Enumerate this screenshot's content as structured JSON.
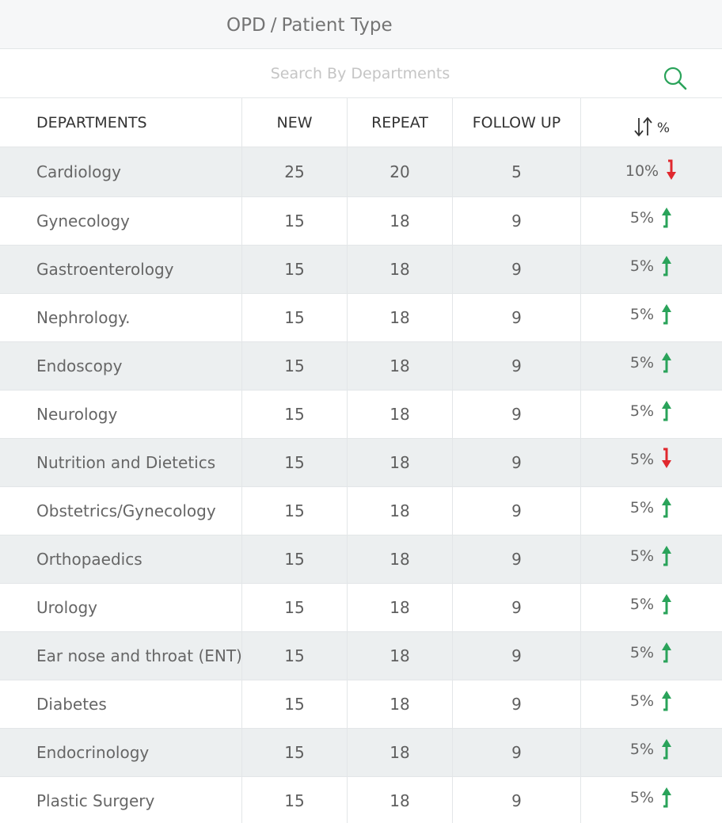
{
  "header": {
    "breadcrumb": [
      "OPD",
      "Patient Type"
    ],
    "separator": "/"
  },
  "search": {
    "placeholder": "Search By Departments",
    "value": ""
  },
  "table": {
    "columns": [
      "DEPARTMENTS",
      "NEW",
      "REPEAT",
      "FOLLOW UP"
    ],
    "pct_label": "%",
    "rows": [
      {
        "dept": "Cardiology",
        "new": "25",
        "repeat": "20",
        "follow_up": "5",
        "pct": "10%",
        "trend": "down"
      },
      {
        "dept": "Gynecology",
        "new": "15",
        "repeat": "18",
        "follow_up": "9",
        "pct": "5%",
        "trend": "up"
      },
      {
        "dept": "Gastroenterology",
        "new": "15",
        "repeat": "18",
        "follow_up": "9",
        "pct": "5%",
        "trend": "up"
      },
      {
        "dept": "Nephrology.",
        "new": "15",
        "repeat": "18",
        "follow_up": "9",
        "pct": "5%",
        "trend": "up"
      },
      {
        "dept": "Endoscopy",
        "new": "15",
        "repeat": "18",
        "follow_up": "9",
        "pct": "5%",
        "trend": "up"
      },
      {
        "dept": "Neurology",
        "new": "15",
        "repeat": "18",
        "follow_up": "9",
        "pct": "5%",
        "trend": "up"
      },
      {
        "dept": "Nutrition and Dietetics",
        "new": "15",
        "repeat": "18",
        "follow_up": "9",
        "pct": "5%",
        "trend": "down"
      },
      {
        "dept": "Obstetrics/Gynecology",
        "new": "15",
        "repeat": "18",
        "follow_up": "9",
        "pct": "5%",
        "trend": "up"
      },
      {
        "dept": "Orthopaedics",
        "new": "15",
        "repeat": "18",
        "follow_up": "9",
        "pct": "5%",
        "trend": "up"
      },
      {
        "dept": "Urology",
        "new": "15",
        "repeat": "18",
        "follow_up": "9",
        "pct": "5%",
        "trend": "up"
      },
      {
        "dept": "Ear nose and throat (ENT)",
        "new": "15",
        "repeat": "18",
        "follow_up": "9",
        "pct": "5%",
        "trend": "up"
      },
      {
        "dept": "Diabetes",
        "new": "15",
        "repeat": "18",
        "follow_up": "9",
        "pct": "5%",
        "trend": "up"
      },
      {
        "dept": "Endocrinology",
        "new": "15",
        "repeat": "18",
        "follow_up": "9",
        "pct": "5%",
        "trend": "up"
      },
      {
        "dept": "Plastic Surgery",
        "new": "15",
        "repeat": "18",
        "follow_up": "9",
        "pct": "5%",
        "trend": "up"
      }
    ]
  },
  "icons": {
    "search": "search-icon",
    "sort": "sort-icon",
    "up": "arrow-up-icon",
    "down": "arrow-down-icon"
  },
  "colors": {
    "up": "#2aa35a",
    "down": "#e0282e",
    "search": "#2aa35a",
    "shade": "#eceff0",
    "topbar": "#f6f7f8"
  }
}
